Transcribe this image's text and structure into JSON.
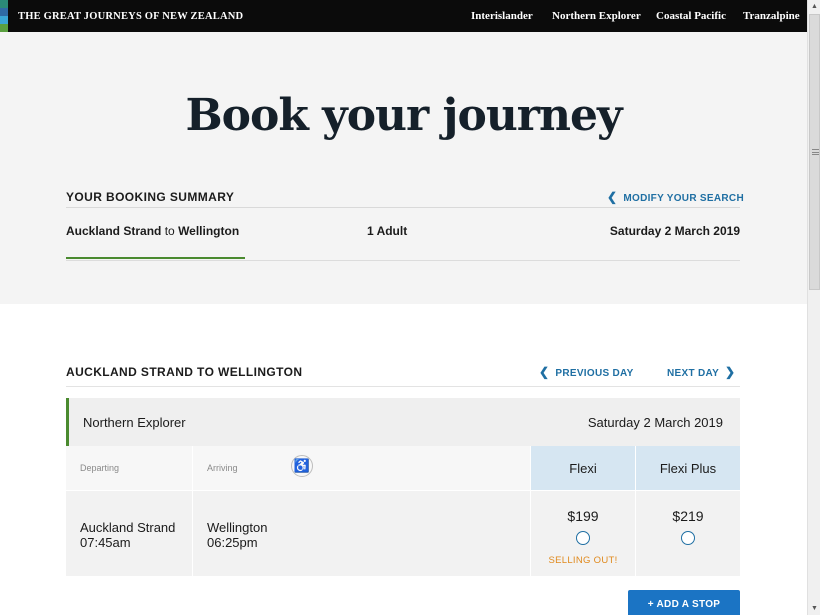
{
  "header": {
    "brand": "THE GREAT JOURNEYS OF NEW ZEALAND",
    "nav": [
      "Interislander",
      "Northern Explorer",
      "Coastal Pacific",
      "Tranzalpine"
    ],
    "stripe_colors": [
      "#2b8a78",
      "#2f6aa5",
      "#3aa6d6",
      "#5aa040"
    ]
  },
  "hero": {
    "title": "Book your journey",
    "summary_title": "YOUR BOOKING SUMMARY",
    "modify_label": "MODIFY YOUR SEARCH",
    "from": "Auckland Strand",
    "to_word": "to",
    "to": "Wellington",
    "passengers": "1 Adult",
    "date": "Saturday 2 March 2019"
  },
  "results": {
    "route_title": "AUCKLAND STRAND TO WELLINGTON",
    "previous_day": "PREVIOUS DAY",
    "next_day": "NEXT DAY",
    "train_name": "Northern Explorer",
    "train_date": "Saturday 2 March 2019",
    "departing_label": "Departing",
    "arriving_label": "Arriving",
    "fares": [
      {
        "name": "Flexi",
        "price": "$199",
        "note": "SELLING OUT!"
      },
      {
        "name": "Flexi Plus",
        "price": "$219",
        "note": ""
      }
    ],
    "departure": {
      "station": "Auckland Strand",
      "time": "07:45am"
    },
    "arrival": {
      "station": "Wellington",
      "time": "06:25pm"
    },
    "add_stop": "+ ADD A STOP"
  },
  "colors": {
    "accent_blue": "#1f6fa3",
    "button_blue": "#1b74c4",
    "green": "#4a8a2f",
    "warning_orange": "#e08a1e",
    "fare_header": "#d6e6f2"
  }
}
